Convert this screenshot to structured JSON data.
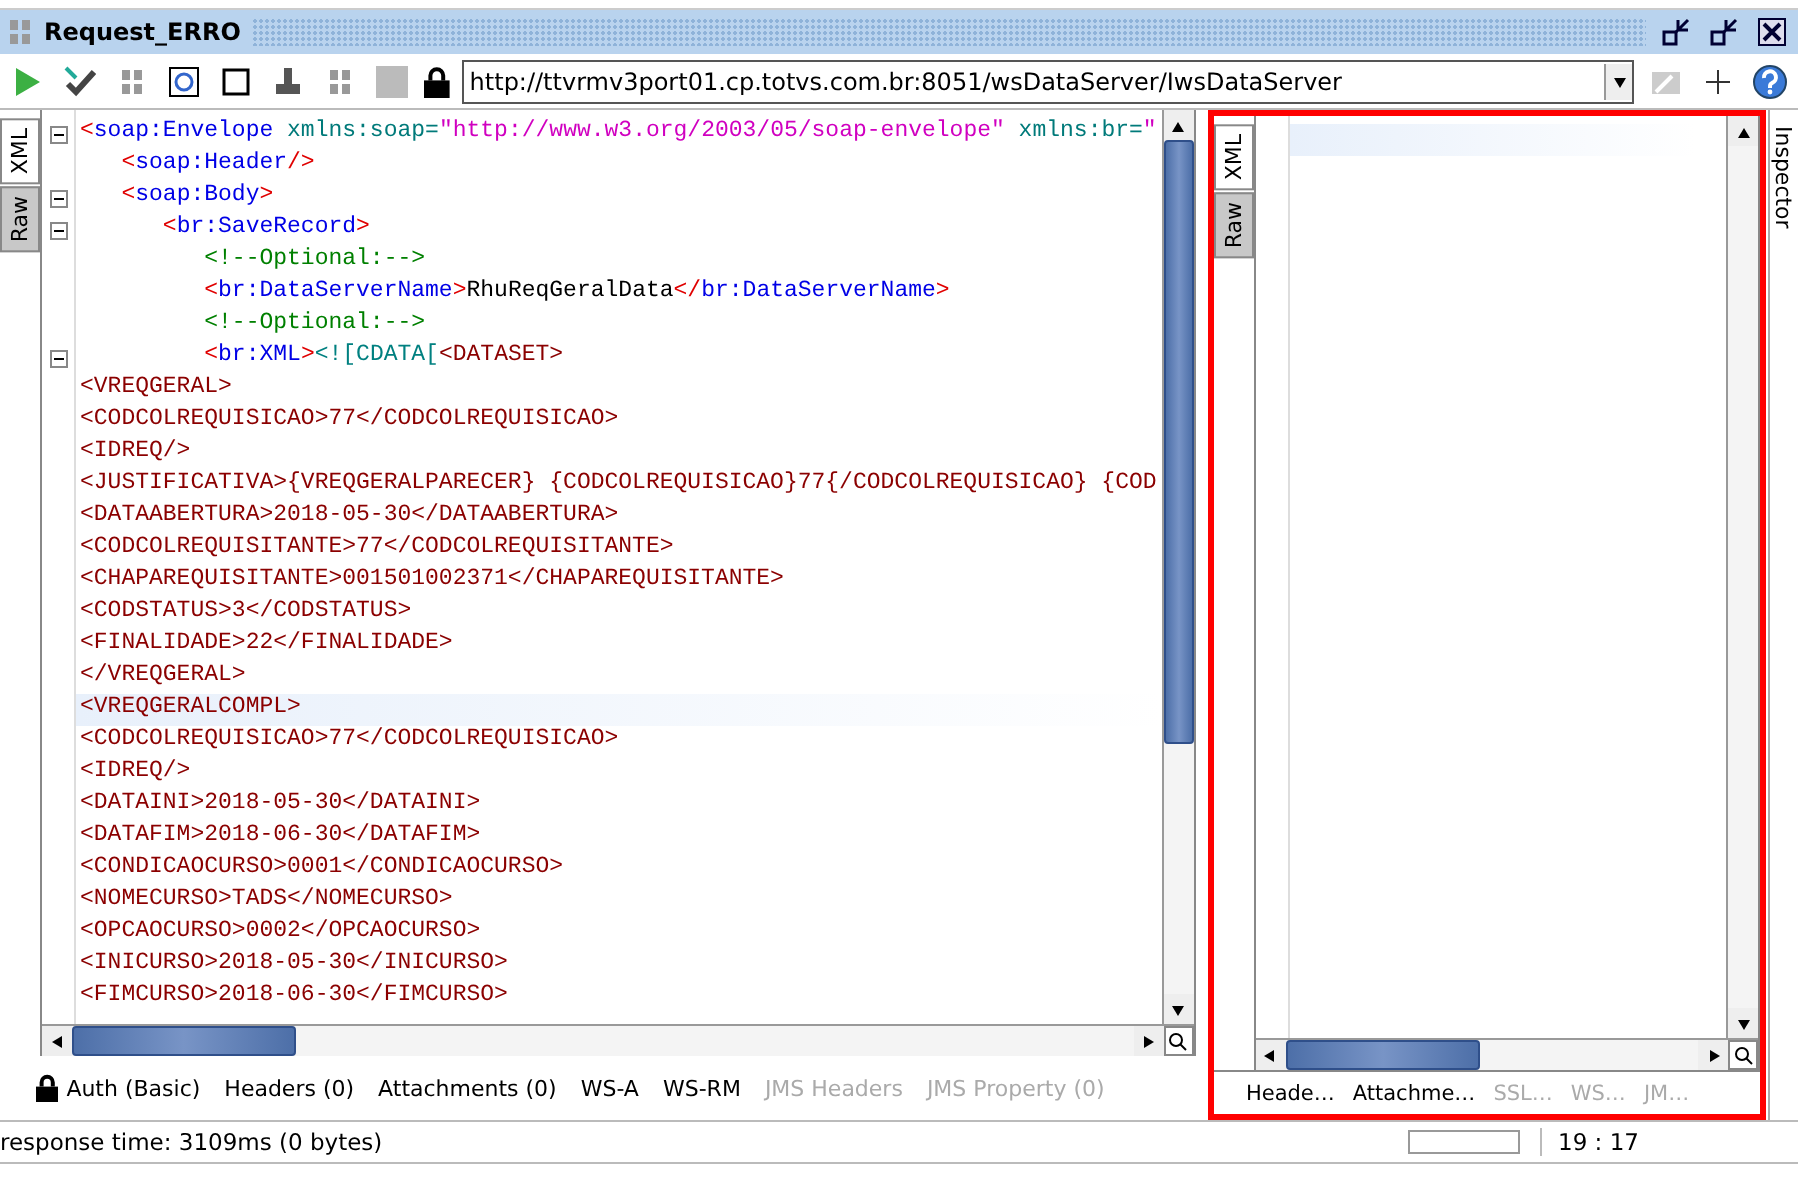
{
  "window": {
    "title": "Request_ERRO"
  },
  "toolbar": {
    "url": "http://ttvrmv3port01.cp.totvs.com.br:8051/wsDataServer/IwsDataServer"
  },
  "request_editor": {
    "view_tabs": [
      {
        "label": "XML",
        "selected": true
      },
      {
        "label": "Raw",
        "selected": false
      }
    ],
    "lines": [
      {
        "foldable": true,
        "highlighted": false,
        "segments": [
          {
            "kind": "punct",
            "text": "<"
          },
          {
            "kind": "tag",
            "text": "soap:Envelope"
          },
          {
            "kind": "attr",
            "text": " xmlns:soap="
          },
          {
            "kind": "value",
            "text": "\"http://www.w3.org/2003/05/soap-envelope\""
          },
          {
            "kind": "attr",
            "text": " xmlns:br="
          },
          {
            "kind": "value",
            "text": "\""
          }
        ]
      },
      {
        "foldable": false,
        "highlighted": false,
        "segments": [
          {
            "kind": "punct",
            "text": "   <"
          },
          {
            "kind": "tag",
            "text": "soap:Header"
          },
          {
            "kind": "punct",
            "text": "/>"
          }
        ]
      },
      {
        "foldable": true,
        "highlighted": false,
        "segments": [
          {
            "kind": "punct",
            "text": "   <"
          },
          {
            "kind": "tag",
            "text": "soap:Body"
          },
          {
            "kind": "punct",
            "text": ">"
          }
        ]
      },
      {
        "foldable": true,
        "highlighted": false,
        "segments": [
          {
            "kind": "punct",
            "text": "      <"
          },
          {
            "kind": "tag",
            "text": "br:SaveRecord"
          },
          {
            "kind": "punct",
            "text": ">"
          }
        ]
      },
      {
        "foldable": false,
        "highlighted": false,
        "segments": [
          {
            "kind": "comment",
            "text": "         <!--Optional:-->"
          }
        ]
      },
      {
        "foldable": false,
        "highlighted": false,
        "segments": [
          {
            "kind": "punct",
            "text": "         <"
          },
          {
            "kind": "tag",
            "text": "br:DataServerName"
          },
          {
            "kind": "punct",
            "text": ">"
          },
          {
            "kind": "text",
            "text": "RhuReqGeralData"
          },
          {
            "kind": "punct",
            "text": "</"
          },
          {
            "kind": "tag",
            "text": "br:DataServerName"
          },
          {
            "kind": "punct",
            "text": ">"
          }
        ]
      },
      {
        "foldable": false,
        "highlighted": false,
        "segments": [
          {
            "kind": "comment",
            "text": "         <!--Optional:-->"
          }
        ]
      },
      {
        "foldable": true,
        "highlighted": false,
        "segments": [
          {
            "kind": "punct",
            "text": "         <"
          },
          {
            "kind": "tag",
            "text": "br:XML"
          },
          {
            "kind": "punct",
            "text": ">"
          },
          {
            "kind": "cdata",
            "text": "<![CDATA["
          },
          {
            "kind": "data",
            "text": "<DATASET>"
          }
        ]
      },
      {
        "foldable": false,
        "highlighted": false,
        "segments": [
          {
            "kind": "data",
            "text": "<VREQGERAL>"
          }
        ]
      },
      {
        "foldable": false,
        "highlighted": false,
        "segments": [
          {
            "kind": "data",
            "text": "<CODCOLREQUISICAO>77</CODCOLREQUISICAO>"
          }
        ]
      },
      {
        "foldable": false,
        "highlighted": false,
        "segments": [
          {
            "kind": "data",
            "text": "<IDREQ/>"
          }
        ]
      },
      {
        "foldable": false,
        "highlighted": false,
        "segments": [
          {
            "kind": "data",
            "text": "<JUSTIFICATIVA>{VREQGERALPARECER} {CODCOLREQUISICAO}77{/CODCOLREQUISICAO} {COD"
          }
        ]
      },
      {
        "foldable": false,
        "highlighted": false,
        "segments": [
          {
            "kind": "data",
            "text": "<DATAABERTURA>2018-05-30</DATAABERTURA>"
          }
        ]
      },
      {
        "foldable": false,
        "highlighted": false,
        "segments": [
          {
            "kind": "data",
            "text": "<CODCOLREQUISITANTE>77</CODCOLREQUISITANTE>"
          }
        ]
      },
      {
        "foldable": false,
        "highlighted": false,
        "segments": [
          {
            "kind": "data",
            "text": "<CHAPAREQUISITANTE>001501002371</CHAPAREQUISITANTE>"
          }
        ]
      },
      {
        "foldable": false,
        "highlighted": false,
        "segments": [
          {
            "kind": "data",
            "text": "<CODSTATUS>3</CODSTATUS>"
          }
        ]
      },
      {
        "foldable": false,
        "highlighted": false,
        "segments": [
          {
            "kind": "data",
            "text": "<FINALIDADE>22</FINALIDADE>"
          }
        ]
      },
      {
        "foldable": false,
        "highlighted": false,
        "segments": [
          {
            "kind": "data",
            "text": "</VREQGERAL>"
          }
        ]
      },
      {
        "foldable": false,
        "highlighted": true,
        "segments": [
          {
            "kind": "data",
            "text": "<VREQGERALCOMPL>"
          }
        ]
      },
      {
        "foldable": false,
        "highlighted": false,
        "segments": [
          {
            "kind": "data",
            "text": "<CODCOLREQUISICAO>77</CODCOLREQUISICAO>"
          }
        ]
      },
      {
        "foldable": false,
        "highlighted": false,
        "segments": [
          {
            "kind": "data",
            "text": "<IDREQ/>"
          }
        ]
      },
      {
        "foldable": false,
        "highlighted": false,
        "segments": [
          {
            "kind": "data",
            "text": "<DATAINI>2018-05-30</DATAINI>"
          }
        ]
      },
      {
        "foldable": false,
        "highlighted": false,
        "segments": [
          {
            "kind": "data",
            "text": "<DATAFIM>2018-06-30</DATAFIM>"
          }
        ]
      },
      {
        "foldable": false,
        "highlighted": false,
        "segments": [
          {
            "kind": "data",
            "text": "<CONDICAOCURSO>0001</CONDICAOCURSO>"
          }
        ]
      },
      {
        "foldable": false,
        "highlighted": false,
        "segments": [
          {
            "kind": "data",
            "text": "<NOMECURSO>TADS</NOMECURSO>"
          }
        ]
      },
      {
        "foldable": false,
        "highlighted": false,
        "segments": [
          {
            "kind": "data",
            "text": "<OPCAOCURSO>0002</OPCAOCURSO>"
          }
        ]
      },
      {
        "foldable": false,
        "highlighted": false,
        "segments": [
          {
            "kind": "data",
            "text": "<INICURSO>2018-05-30</INICURSO>"
          }
        ]
      },
      {
        "foldable": false,
        "highlighted": false,
        "segments": [
          {
            "kind": "data",
            "text": "<FIMCURSO>2018-06-30</FIMCURSO>"
          }
        ]
      }
    ],
    "bottom_tabs": [
      {
        "label": "Auth (Basic)",
        "kind": "locked",
        "disabled": false
      },
      {
        "label": "Headers (0)",
        "kind": "plain",
        "disabled": false
      },
      {
        "label": "Attachments (0)",
        "kind": "plain",
        "disabled": false
      },
      {
        "label": "WS-A",
        "kind": "plain",
        "disabled": false
      },
      {
        "label": "WS-RM",
        "kind": "plain",
        "disabled": false
      },
      {
        "label": "JMS Headers",
        "kind": "plain",
        "disabled": true
      },
      {
        "label": "JMS Property (0)",
        "kind": "plain",
        "disabled": true
      }
    ]
  },
  "response_editor": {
    "view_tabs": [
      {
        "label": "XML",
        "selected": true
      },
      {
        "label": "Raw",
        "selected": false
      }
    ],
    "bottom_tabs": [
      {
        "label": "Heade…",
        "disabled": false
      },
      {
        "label": "Attachme…",
        "disabled": false
      },
      {
        "label": "SSL…",
        "disabled": true
      },
      {
        "label": "WS…",
        "disabled": true
      },
      {
        "label": "JM…",
        "disabled": true
      }
    ]
  },
  "inspector": {
    "label": "Inspector"
  },
  "status_bar": {
    "message": "response time: 3109ms (0 bytes)",
    "position": "19 : 17",
    "level": 0
  }
}
